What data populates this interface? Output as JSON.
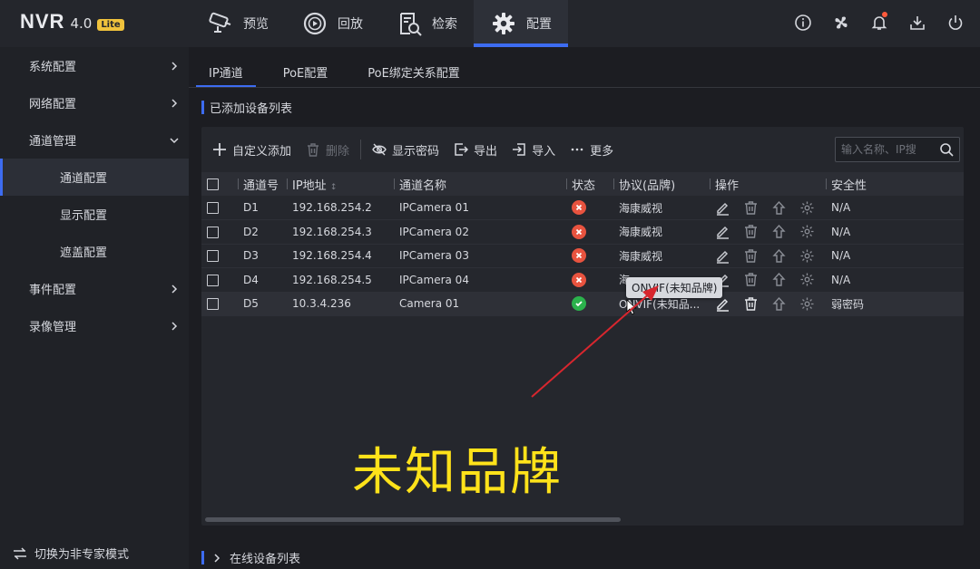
{
  "app": {
    "logo": "NVR",
    "version": "4.0",
    "badge": "Lite"
  },
  "nav": [
    {
      "label": "预览",
      "icon": "camera-icon"
    },
    {
      "label": "回放",
      "icon": "playback-icon"
    },
    {
      "label": "检索",
      "icon": "search-doc-icon"
    },
    {
      "label": "配置",
      "icon": "gear-icon",
      "active": true
    }
  ],
  "top_icons": [
    "info-icon",
    "fan-icon",
    "bell-icon",
    "download-icon",
    "power-icon"
  ],
  "sidebar": {
    "items": [
      {
        "label": "系统配置",
        "level": 1,
        "chevron": "right"
      },
      {
        "label": "网络配置",
        "level": 1,
        "chevron": "right"
      },
      {
        "label": "通道管理",
        "level": 1,
        "chevron": "down"
      },
      {
        "label": "通道配置",
        "level": 2,
        "selected": true
      },
      {
        "label": "显示配置",
        "level": 2
      },
      {
        "label": "遮盖配置",
        "level": 2
      },
      {
        "label": "事件配置",
        "level": 1,
        "chevron": "right"
      },
      {
        "label": "录像管理",
        "level": 1,
        "chevron": "right"
      }
    ],
    "bottom_label": "切换为非专家模式"
  },
  "tabs": [
    {
      "label": "IP通道",
      "active": true
    },
    {
      "label": "PoE配置"
    },
    {
      "label": "PoE绑定关系配置"
    }
  ],
  "section_title": "已添加设备列表",
  "toolbar": {
    "add": "自定义添加",
    "delete": "删除",
    "show_password": "显示密码",
    "export": "导出",
    "import": "导入",
    "more": "更多",
    "search_placeholder": "输入名称、IP搜"
  },
  "table": {
    "headers": [
      "通道号",
      "IP地址",
      "通道名称",
      "状态",
      "协议(品牌)",
      "操作",
      "安全性"
    ],
    "rows": [
      {
        "channel": "D1",
        "ip": "192.168.254.2",
        "name": "IPCamera 01",
        "status": "offline",
        "protocol": "海康威视",
        "security": "N/A"
      },
      {
        "channel": "D2",
        "ip": "192.168.254.3",
        "name": "IPCamera 02",
        "status": "offline",
        "protocol": "海康威视",
        "security": "N/A"
      },
      {
        "channel": "D3",
        "ip": "192.168.254.4",
        "name": "IPCamera 03",
        "status": "offline",
        "protocol": "海康威视",
        "security": "N/A"
      },
      {
        "channel": "D4",
        "ip": "192.168.254.5",
        "name": "IPCamera 04",
        "status": "offline",
        "protocol": "海",
        "security": "N/A"
      },
      {
        "channel": "D5",
        "ip": "10.3.4.236",
        "name": "Camera 01",
        "status": "online",
        "protocol": "ONVIF(未知品...",
        "security": "弱密码"
      }
    ]
  },
  "tooltip": "ONVIF(未知品牌)",
  "annotation": "未知品牌",
  "online_section": "在线设备列表",
  "colors": {
    "accent": "#3d6cf1",
    "offline": "#e8533f",
    "online": "#2bb24c",
    "annotation": "#ffe21a",
    "arrow": "#d8262e"
  }
}
